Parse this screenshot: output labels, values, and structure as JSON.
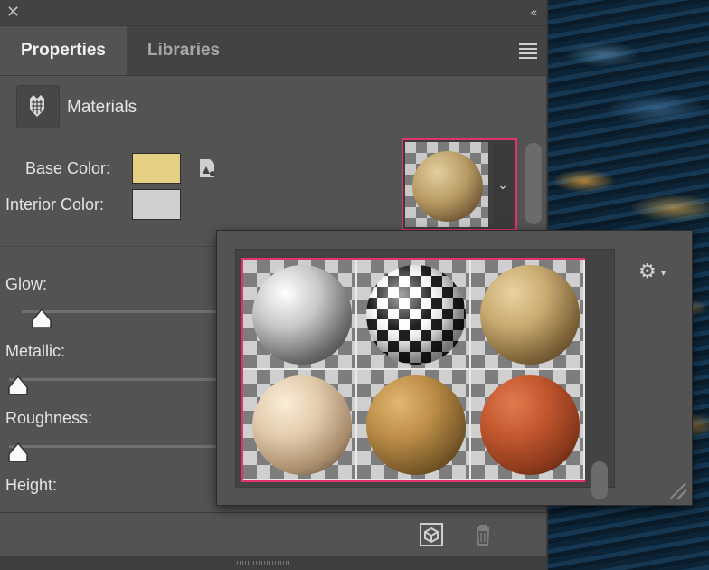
{
  "window": {
    "close_glyph": "✕",
    "collapse_glyph": "‹‹"
  },
  "tabs": [
    {
      "label": "Properties"
    },
    {
      "label": "Libraries"
    }
  ],
  "section": {
    "icon": "materials-icon",
    "title": "Materials"
  },
  "fields": {
    "base_color": {
      "label": "Base Color:",
      "value": "#e5cf82"
    },
    "interior_color": {
      "label": "Interior Color:",
      "value": "#d0d0d0"
    }
  },
  "sliders": [
    {
      "label": "Glow:",
      "value": 0.03
    },
    {
      "label": "Metallic:",
      "value": 0
    },
    {
      "label": "Roughness:",
      "value": 0
    },
    {
      "label": "Height:",
      "value": null
    }
  ],
  "preview": {
    "material": "sandstone",
    "dropdown_glyph": "⌄"
  },
  "material_picker": {
    "materials": [
      {
        "name": "white-gloss",
        "colors": [
          "#ffffff",
          "#c8c8c8",
          "#6a6a6a",
          "#2a2a2a"
        ]
      },
      {
        "name": "checker-sphere",
        "colors": [
          "#ffffff",
          "#e0e0e0",
          "#222222",
          "#111111"
        ]
      },
      {
        "name": "sandstone",
        "colors": [
          "#e9d3a2",
          "#c8aa70",
          "#7c6238",
          "#3e2f18"
        ]
      },
      {
        "name": "marble-cream",
        "colors": [
          "#fbeeda",
          "#e2cbab",
          "#a88c6c",
          "#3b3026"
        ]
      },
      {
        "name": "rough-sand",
        "colors": [
          "#e2b770",
          "#bd8f48",
          "#7b5a2a",
          "#3a2810"
        ]
      },
      {
        "name": "terracotta",
        "colors": [
          "#e37a4e",
          "#c2572e",
          "#8a391c",
          "#3d170a"
        ]
      }
    ]
  },
  "colors": {
    "accent": "#e0326b",
    "panel": "#535353"
  }
}
